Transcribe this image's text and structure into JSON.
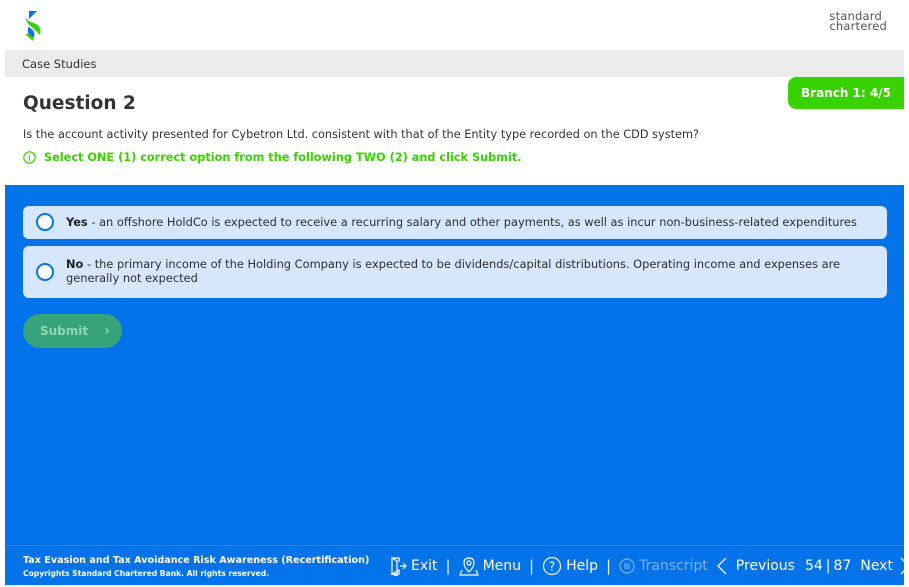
{
  "header": {
    "brand_line1": "standard",
    "brand_line2": "chartered",
    "logo_icon": "sc-logo-icon"
  },
  "breadcrumb": "Case Studies",
  "branch_badge": "Branch 1: 4/5",
  "question": {
    "title": "Question 2",
    "text": "Is the account activity presented for Cybetron Ltd. consistent with that of the Entity type recorded on the CDD system?",
    "instruction": "Select ONE (1) correct option from the following TWO (2) and click Submit."
  },
  "options": [
    {
      "label": "Yes",
      "text": " - an offshore HoldCo is expected to receive a recurring salary and other payments, as well as incur non-business-related expenditures"
    },
    {
      "label": "No",
      "text": " - the primary income of the Holding Company is expected to be dividends/capital distributions. Operating income and expenses are generally not expected"
    }
  ],
  "submit": {
    "label": "Submit",
    "icon": "chevron-right-icon"
  },
  "footer": {
    "course_title": "Tax Evasion and Tax Avoidance Risk Awareness (Recertification)",
    "copyright": "Copyrights Standard Chartered Bank. All rights reserved.",
    "exit": "Exit",
    "menu": "Menu",
    "help": "Help",
    "transcript": "Transcript",
    "previous": "Previous",
    "page_current": "54",
    "page_total": "87",
    "next": "Next"
  },
  "colors": {
    "blue": "#0473ea",
    "green": "#38d200",
    "submit_disabled": "#37a37a"
  }
}
